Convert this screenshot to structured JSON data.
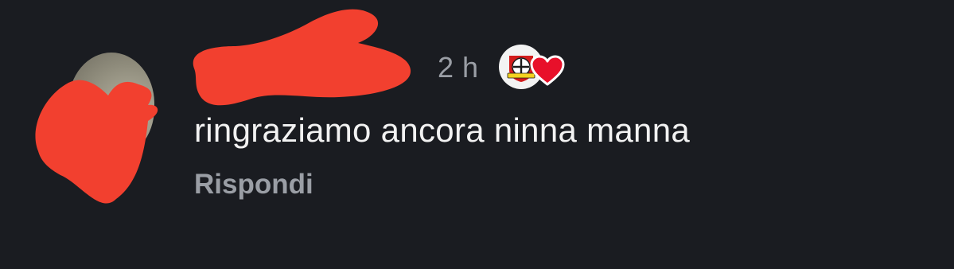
{
  "comment": {
    "username": "",
    "timestamp": "2 h",
    "text": "ringraziamo ancora ninna manna",
    "reply_label": "Rispondi",
    "badge_icon": "football-club-crest-icon",
    "reaction_icon": "heart-icon",
    "colors": {
      "background": "#1a1c21",
      "text": "#f2f2f2",
      "secondary_text": "#9a9ea5",
      "redaction": "#f2402f",
      "heart": "#e8102a"
    }
  }
}
